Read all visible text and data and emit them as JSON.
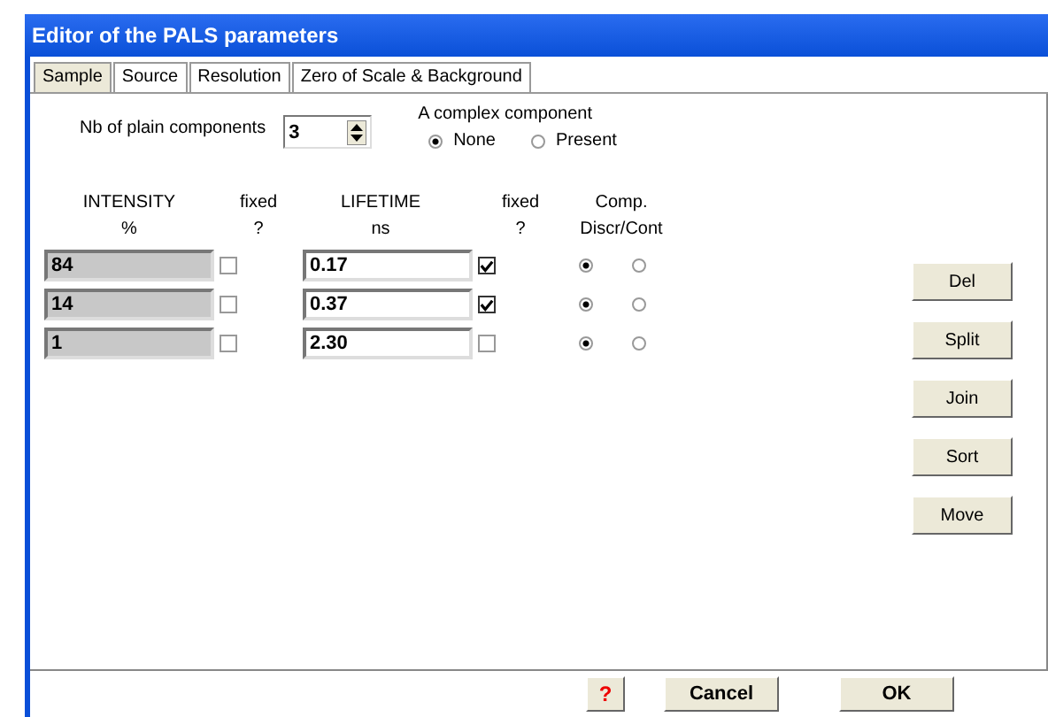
{
  "window": {
    "title": "Editor of the PALS parameters"
  },
  "tabs": [
    {
      "label": "Sample",
      "selected": true
    },
    {
      "label": "Source",
      "selected": false
    },
    {
      "label": "Resolution",
      "selected": false
    },
    {
      "label": "Zero of Scale & Background",
      "selected": false
    }
  ],
  "plain_components": {
    "label": "Nb of plain components",
    "value": "3"
  },
  "complex_component": {
    "label": "A complex component",
    "options": [
      {
        "label": "None",
        "selected": true
      },
      {
        "label": "Present",
        "selected": false
      }
    ]
  },
  "columns": [
    {
      "title": "INTENSITY",
      "unit": "%"
    },
    {
      "title": "fixed",
      "unit": "?"
    },
    {
      "title": "LIFETIME",
      "unit": "ns"
    },
    {
      "title": "fixed",
      "unit": "?"
    },
    {
      "title": "Comp.",
      "unit": "Discr/Cont"
    }
  ],
  "rows": [
    {
      "intensity": "84",
      "intensity_fixed": false,
      "lifetime": "0.17",
      "lifetime_fixed": true,
      "discrete": true
    },
    {
      "intensity": "14",
      "intensity_fixed": false,
      "lifetime": "0.37",
      "lifetime_fixed": true,
      "discrete": true
    },
    {
      "intensity": "1",
      "intensity_fixed": false,
      "lifetime": "2.30",
      "lifetime_fixed": false,
      "discrete": true
    }
  ],
  "side_buttons": [
    "Del",
    "Split",
    "Join",
    "Sort",
    "Move"
  ],
  "footer": {
    "help": "?",
    "buttons": [
      "Cancel",
      "OK"
    ]
  }
}
